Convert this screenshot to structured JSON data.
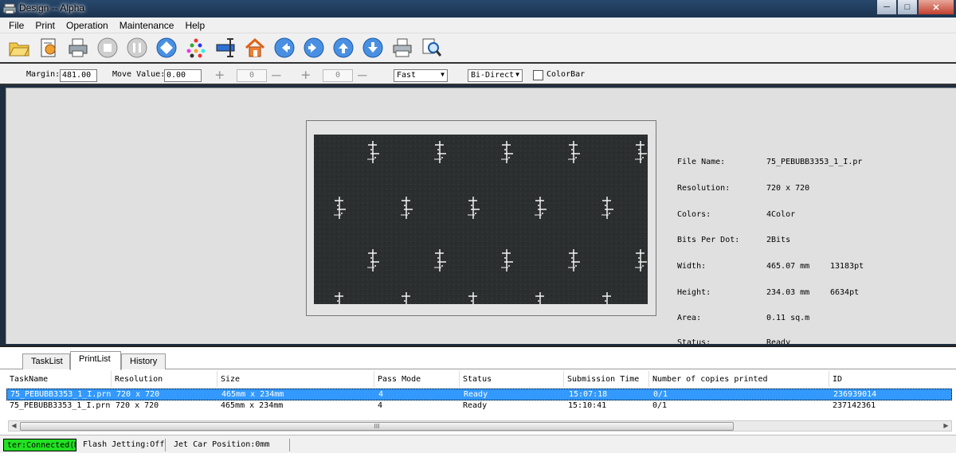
{
  "window": {
    "title": "Design  -- Alpha"
  },
  "menu": [
    "File",
    "Print",
    "Operation",
    "Maintenance",
    "Help"
  ],
  "toolbar": {
    "icons": [
      "open-folder-icon",
      "settings-document-icon",
      "printer-icon",
      "stop-icon",
      "pause-icon",
      "diamond-icon",
      "color-dots-icon",
      "align-icon",
      "home-icon",
      "arrow-left-icon",
      "arrow-right-icon",
      "arrow-up-icon",
      "arrow-down-icon",
      "print-preview-icon",
      "zoom-icon"
    ]
  },
  "settings": {
    "margin_label": "Margin:",
    "margin_value": "481.00",
    "move_label": "Move Value:",
    "move_value": "0.00",
    "plus1": "0",
    "plus2": "0",
    "speed": "Fast",
    "direction": "Bi-Direct",
    "colorbar_label": "ColorBar"
  },
  "info": {
    "file_name_label": "File Name:",
    "file_name": "75_PEBUBB3353_1_I.pr",
    "resolution_label": "Resolution:",
    "resolution": "720 x 720",
    "colors_label": "Colors:",
    "colors": "4Color",
    "bits_label": "Bits Per Dot:",
    "bits": "2Bits",
    "width_label": "Width:",
    "width_mm": "465.07 mm",
    "width_pt": "13183pt",
    "height_label": "Height:",
    "height_mm": "234.03 mm",
    "height_pt": "6634pt",
    "area_label": "Area:",
    "area": "0.11 sq.m",
    "status_label": "Status:",
    "status": "Ready"
  },
  "tabs": [
    "TaskList",
    "PrintList",
    "History"
  ],
  "table": {
    "headers": [
      "TaskName",
      "Resolution",
      "Size",
      "Pass Mode",
      "Status",
      "Submission Time",
      "Number of copies printed",
      "ID"
    ],
    "rows": [
      [
        "75_PEBUBB3353_1_I.prn",
        "720 x 720",
        "465mm x 234mm",
        "4",
        "Ready",
        "15:07:18",
        "0/1",
        "236939014"
      ],
      [
        "75_PEBUBB3353_1_I.prn",
        "720 x 720",
        "465mm x 234mm",
        "4",
        "Ready",
        "15:10:41",
        "0/1",
        "237142361"
      ]
    ],
    "scroll_grip": "III"
  },
  "status": {
    "connection": "ter:Connected(M",
    "flash": "Flash Jetting:Off",
    "jet": "Jet Car Position:0mm"
  }
}
